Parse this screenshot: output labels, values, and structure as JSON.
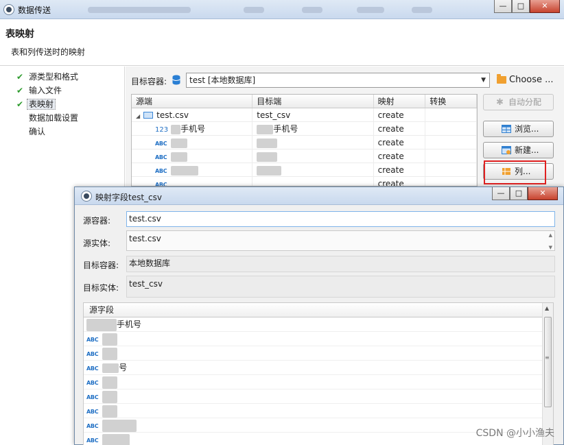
{
  "window": {
    "title": "数据传送",
    "min_icon": "minimize-icon",
    "max_icon": "maximize-icon",
    "close_icon": "close-icon"
  },
  "header": {
    "title": "表映射",
    "subtitle": "表和列传送时的映射"
  },
  "nav": {
    "items": [
      {
        "label": "源类型和格式",
        "checked": true
      },
      {
        "label": "输入文件",
        "checked": true
      },
      {
        "label": "表映射",
        "checked": true,
        "active": true
      },
      {
        "label": "数据加载设置",
        "checked": false
      },
      {
        "label": "确认",
        "checked": false
      }
    ]
  },
  "target_container": {
    "label": "目标容器:",
    "value": "test  [本地数据库]",
    "choose_label": "Choose ..."
  },
  "mapping_table": {
    "columns": [
      "源端",
      "目标端",
      "映射",
      "转换"
    ],
    "group": {
      "source": "test.csv",
      "target": "test_csv",
      "mapping": "create"
    },
    "rows": [
      {
        "type_icon": "123",
        "source": "手机号",
        "target": "手机号",
        "mapping": "create"
      },
      {
        "type_icon": "ABC",
        "source": "",
        "target": "",
        "mapping": "create"
      },
      {
        "type_icon": "ABC",
        "source": "",
        "target": "",
        "mapping": "create"
      },
      {
        "type_icon": "ABC",
        "source": "",
        "target": "",
        "mapping": "create"
      },
      {
        "type_icon": "ABC",
        "source": "",
        "target": "",
        "mapping": "create"
      }
    ]
  },
  "side_buttons": {
    "auto_assign": "自动分配",
    "browse": "浏览...",
    "new": "新建...",
    "columns": "列..."
  },
  "dialog": {
    "title": "映射字段test_csv",
    "source_container_label": "源容器:",
    "source_container_value": "test.csv",
    "source_entity_label": "源实体:",
    "source_entity_value": "test.csv",
    "target_container_label": "目标容器:",
    "target_container_value": "本地数据库",
    "target_entity_label": "目标实体:",
    "target_entity_value": "test_csv",
    "list_header": "源字段",
    "fields": [
      {
        "icon": "",
        "text": "手机号"
      },
      {
        "icon": "ABC",
        "text": ""
      },
      {
        "icon": "ABC",
        "text": ""
      },
      {
        "icon": "ABC",
        "text": "号"
      },
      {
        "icon": "ABC",
        "text": ""
      },
      {
        "icon": "ABC",
        "text": ""
      },
      {
        "icon": "ABC",
        "text": ""
      },
      {
        "icon": "ABC",
        "text": ""
      },
      {
        "icon": "ABC",
        "text": ""
      }
    ]
  },
  "watermark": "CSDN @小小渔夫"
}
